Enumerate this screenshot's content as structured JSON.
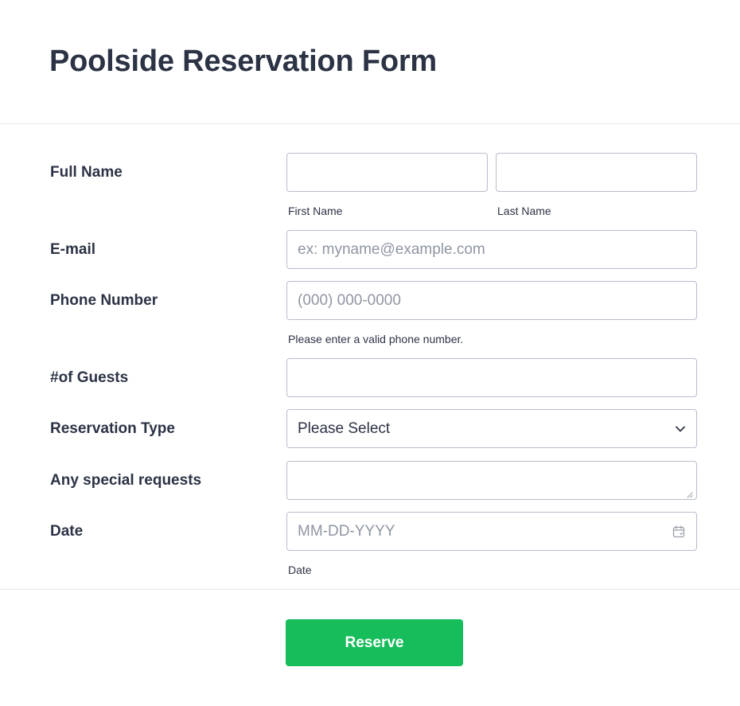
{
  "form": {
    "title": "Poolside Reservation Form"
  },
  "fields": {
    "full_name": {
      "label": "Full Name",
      "first_value": "",
      "first_sublabel": "First Name",
      "last_value": "",
      "last_sublabel": "Last Name"
    },
    "email": {
      "label": "E-mail",
      "value": "",
      "placeholder": "ex: myname@example.com"
    },
    "phone": {
      "label": "Phone Number",
      "value": "",
      "placeholder": "(000) 000-0000",
      "sublabel": "Please enter a valid phone number."
    },
    "guests": {
      "label": "#of Guests",
      "value": ""
    },
    "reservation_type": {
      "label": "Reservation Type",
      "selected": "Please Select"
    },
    "special_requests": {
      "label": "Any special requests",
      "value": ""
    },
    "date": {
      "label": "Date",
      "value": "",
      "placeholder": "MM-DD-YYYY",
      "sublabel": "Date"
    }
  },
  "icons": {
    "select": "chevron-down-icon",
    "date": "calendar-icon",
    "textarea": "resize-handle-icon"
  },
  "colors": {
    "accent": "#18bd5b",
    "text": "#2c3345",
    "border": "#b8bdc9"
  },
  "submit": {
    "label": "Reserve"
  }
}
